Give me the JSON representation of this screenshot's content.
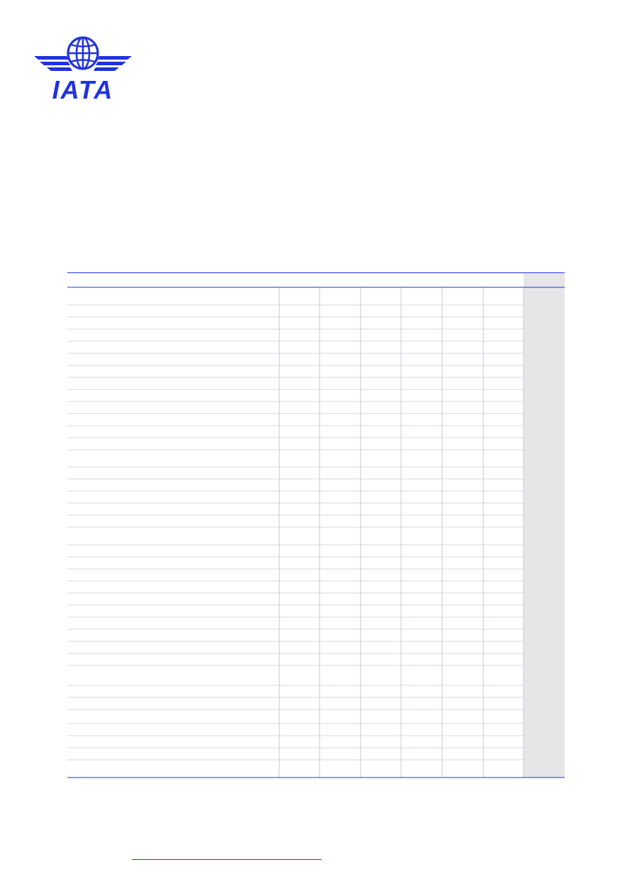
{
  "logo": {
    "text": "IATA",
    "color": "#2233dd"
  },
  "colors": {
    "rule": "#2233dd",
    "row_line": "#d8d8e2",
    "col_line": "#c9c9d6",
    "shaded_column": "#e6e5e8"
  },
  "table": {
    "columns": 8,
    "row_count": 38
  }
}
